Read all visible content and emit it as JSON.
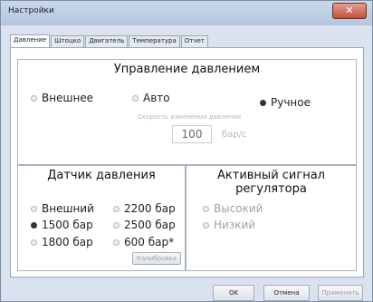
{
  "window": {
    "title": "Настройки"
  },
  "tabs": [
    "Давление",
    "Штоцко",
    "Двигатель",
    "Температура",
    "Отчет"
  ],
  "pressure_control": {
    "title": "Управление давлением",
    "external": "Внешнее",
    "auto": "Авто",
    "manual": "Ручное",
    "rate_label": "Скорость изменения давления",
    "rate_value": "100",
    "rate_unit": "бар/с"
  },
  "sensor": {
    "title": "Датчик давления",
    "external": "Внешний",
    "b1500": "1500 бар",
    "b1800": "1800 бар",
    "b2200": "2200 бар",
    "b2500": "2500 бар",
    "b600": "600 бар*",
    "calibrate": "Калибровка"
  },
  "signal": {
    "title": "Активный сигнал регулятора",
    "high": "Высокий",
    "low": "Низкий"
  },
  "footer": {
    "ok": "OK",
    "cancel": "Отмена",
    "apply": "Применить"
  }
}
